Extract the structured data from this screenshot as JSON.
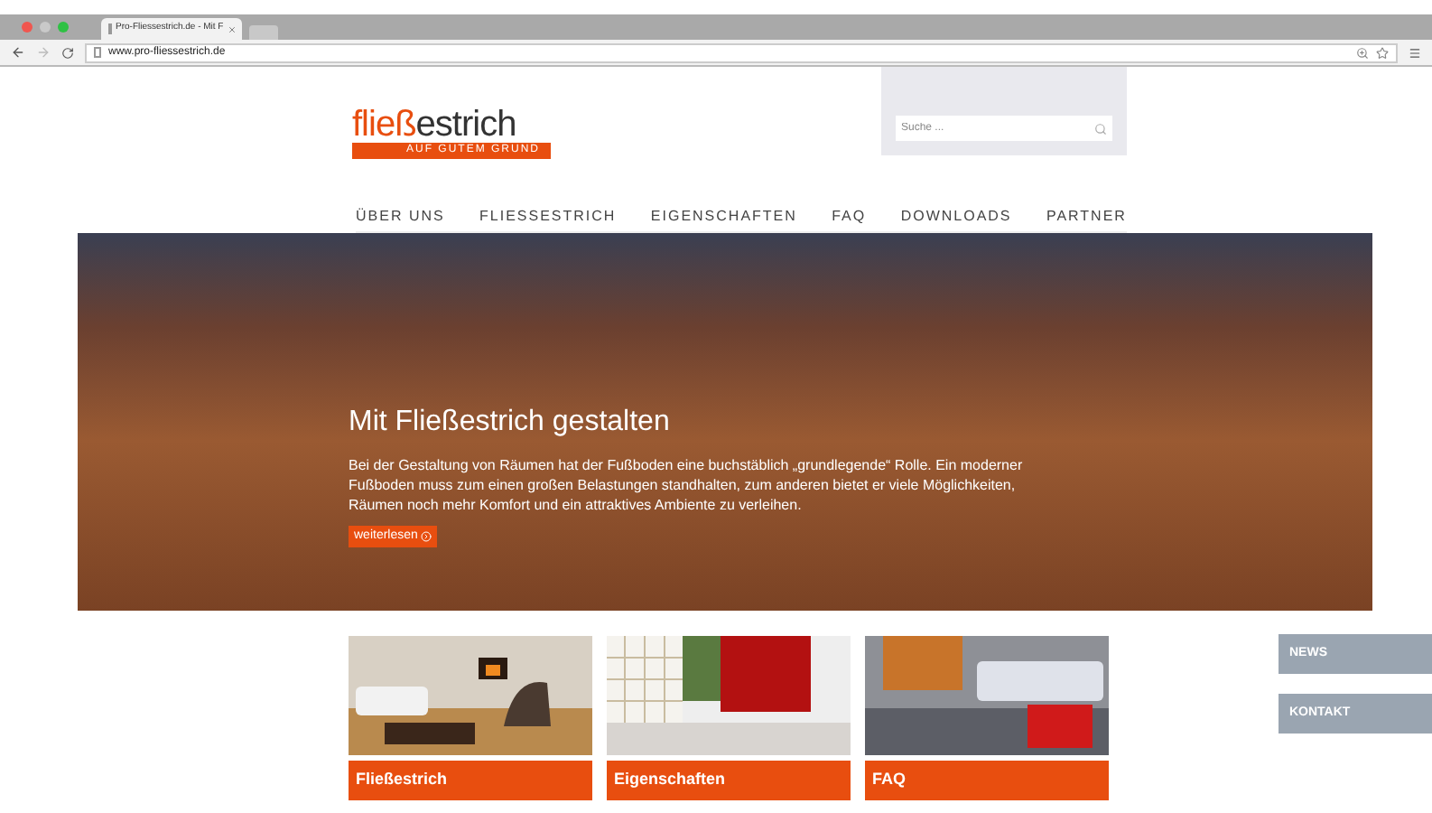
{
  "browser": {
    "tab_title": "Pro-Fliessestrich.de - Mit F",
    "url": "www.pro-fliessestrich.de"
  },
  "logo": {
    "accent": "fließ",
    "rest": "estrich",
    "tagline": "AUF GUTEM GRUND"
  },
  "search": {
    "placeholder": "Suche ..."
  },
  "nav": [
    {
      "label": "ÜBER UNS",
      "selected": false
    },
    {
      "label": "FLIESSESTRICH",
      "selected": false
    },
    {
      "label": "EIGENSCHAFTEN",
      "selected": false
    },
    {
      "label": "FAQ",
      "selected": false
    },
    {
      "label": "DOWNLOADS",
      "selected": false
    },
    {
      "label": "PARTNER",
      "selected": false
    }
  ],
  "hero": {
    "title": "Mit Fließestrich gestalten",
    "text": "Bei der Gestaltung von Räumen hat der Fußboden eine buchstäblich „grundlegende“ Rolle. Ein moderner Fußboden muss zum einen großen Belastungen standhalten, zum anderen bietet er viele Möglichkeiten, Räumen noch mehr Komfort und ein attraktives Ambiente zu verleihen.",
    "button": "weiterlesen"
  },
  "cards": [
    {
      "label": "Fließestrich",
      "kind": "living"
    },
    {
      "label": "Eigenschaften",
      "kind": "shelf"
    },
    {
      "label": "FAQ",
      "kind": "bedroom"
    }
  ],
  "side_tabs": [
    "NEWS",
    "KONTAKT"
  ]
}
